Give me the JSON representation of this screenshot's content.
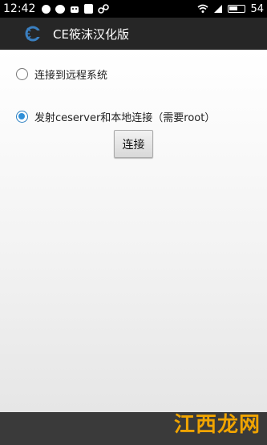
{
  "status_bar": {
    "time": "12:42",
    "battery": "54",
    "icons": [
      "sun-icon",
      "chat-icon",
      "android-icon",
      "bag-icon",
      "link-icon",
      "wifi-icon",
      "sim-icon",
      "battery-icon"
    ]
  },
  "app_bar": {
    "title": "CE筱沫汉化版",
    "logo_icon": "cheat-engine-logo-icon"
  },
  "options": {
    "remote": {
      "label": "连接到远程系统",
      "checked": false
    },
    "local": {
      "label": "发射ceserver和本地连接（需要root）",
      "checked": true
    }
  },
  "connect_button": {
    "label": "连接"
  },
  "watermark": {
    "text": "江西龙网"
  },
  "colors": {
    "accent": "#2f8fd8",
    "app_bar": "#262626",
    "status_bar": "#000000",
    "watermark": "#f0a400"
  }
}
